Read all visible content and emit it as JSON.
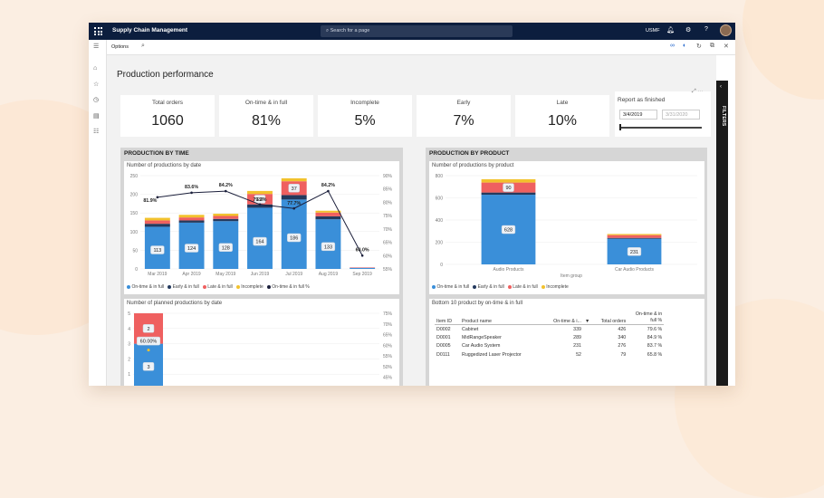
{
  "app": {
    "title": "Supply Chain Management",
    "search_placeholder": "Search for a page",
    "company": "USMF",
    "options_label": "Options"
  },
  "page": {
    "title": "Production performance"
  },
  "kpis": [
    {
      "label": "Total orders",
      "value": "1060"
    },
    {
      "label": "On-time & in full",
      "value": "81%"
    },
    {
      "label": "Incomplete",
      "value": "5%"
    },
    {
      "label": "Early",
      "value": "7%"
    },
    {
      "label": "Late",
      "value": "10%"
    }
  ],
  "slicer": {
    "label": "Report as finished",
    "start": "3/4/2019",
    "end": "3/31/2020",
    "level": 0
  },
  "filters_label": "FILTERS",
  "panels": {
    "by_time": "PRODUCTION BY TIME",
    "by_product": "PRODUCTION BY PRODUCT"
  },
  "colors": {
    "on_time": "#3a8fd9",
    "early": "#243a5e",
    "late": "#ef6060",
    "incomplete": "#f2c22d",
    "line": "#1b1f3b",
    "topbar": "#0c1e3e"
  },
  "legend": [
    "On-time & in full",
    "Early & in full",
    "Late & in full",
    "Incomplete",
    "On-time & in full %"
  ],
  "chart_data": [
    {
      "type": "bar",
      "title": "Number of productions by date",
      "categories": [
        "Mar 2019",
        "Apr 2019",
        "May 2019",
        "Jun 2019",
        "Jul 2019",
        "Aug 2019",
        "Sep 2019"
      ],
      "series": [
        {
          "name": "On-time & in full",
          "values": [
            113,
            124,
            128,
            164,
            186,
            133,
            3
          ]
        },
        {
          "name": "Early & in full",
          "values": [
            8,
            6,
            6,
            9,
            12,
            8,
            0
          ]
        },
        {
          "name": "Late & in full",
          "values": [
            9,
            8,
            8,
            28,
            37,
            10,
            1
          ]
        },
        {
          "name": "Incomplete",
          "values": [
            7,
            7,
            6,
            8,
            8,
            5,
            0
          ]
        }
      ],
      "line": {
        "name": "On-time & in full %",
        "values": [
          81.9,
          83.6,
          84.2,
          79.2,
          77.7,
          84.2,
          60.0
        ],
        "labels": [
          "81.9%",
          "83.6%",
          "84.2%",
          "79.2%",
          "77.7%",
          "84.2%",
          "60.0%"
        ]
      },
      "ylim": [
        0,
        250
      ],
      "yticks": [
        "0",
        "50",
        "100",
        "150",
        "200",
        "250"
      ],
      "y2lim": [
        55,
        90
      ],
      "y2ticks": [
        "55%",
        "60%",
        "65%",
        "70%",
        "75%",
        "80%",
        "85%",
        "90%"
      ],
      "bar_labels": [
        "113",
        "124",
        "128",
        "164",
        "186",
        "133",
        ""
      ],
      "late_labels": [
        "",
        "",
        "",
        "28",
        "37",
        "",
        ""
      ]
    },
    {
      "type": "bar",
      "title": "Number of productions by product",
      "categories": [
        "Audio Products",
        "Car Audio Products"
      ],
      "xlabel": "Item group",
      "series": [
        {
          "name": "On-time & in full",
          "values": [
            628,
            231
          ]
        },
        {
          "name": "Early & in full",
          "values": [
            20,
            8
          ]
        },
        {
          "name": "Late & in full",
          "values": [
            90,
            25
          ]
        },
        {
          "name": "Incomplete",
          "values": [
            30,
            10
          ]
        }
      ],
      "ylim": [
        0,
        800
      ],
      "yticks": [
        "0",
        "200",
        "400",
        "600",
        "800"
      ],
      "bar_labels": [
        "628",
        "231"
      ],
      "late_labels": [
        "90",
        ""
      ]
    },
    {
      "type": "bar",
      "title": "Number of planned productions by date",
      "categories": [
        "Mar 2019"
      ],
      "series": [
        {
          "name": "On-time & in full",
          "values": [
            3
          ]
        },
        {
          "name": "Late & in full",
          "values": [
            2
          ]
        }
      ],
      "ylim": [
        0,
        5
      ],
      "yticks": [
        "0",
        "1",
        "2",
        "3",
        "4",
        "5"
      ],
      "y2ticks": [
        "40%",
        "45%",
        "50%",
        "55%",
        "60%",
        "65%",
        "70%",
        "75%"
      ],
      "point_label": "60.00%",
      "bar_labels": [
        "3"
      ],
      "late_labels": [
        "2"
      ]
    },
    {
      "type": "table",
      "title": "Bottom 10 product by on-time & in full",
      "columns": [
        "Item ID",
        "Product name",
        "On-time & i...",
        "Total orders",
        "On-time & in full %"
      ],
      "rows": [
        [
          "D0002",
          "Cabinet",
          "339",
          "426",
          "79.6 %"
        ],
        [
          "D0001",
          "MidRangeSpeaker",
          "289",
          "340",
          "84.9 %"
        ],
        [
          "D0005",
          "Car Audio System",
          "231",
          "276",
          "83.7 %"
        ],
        [
          "D0111",
          "Ruggedized Laser Projector",
          "52",
          "79",
          "65.8 %"
        ]
      ]
    }
  ]
}
